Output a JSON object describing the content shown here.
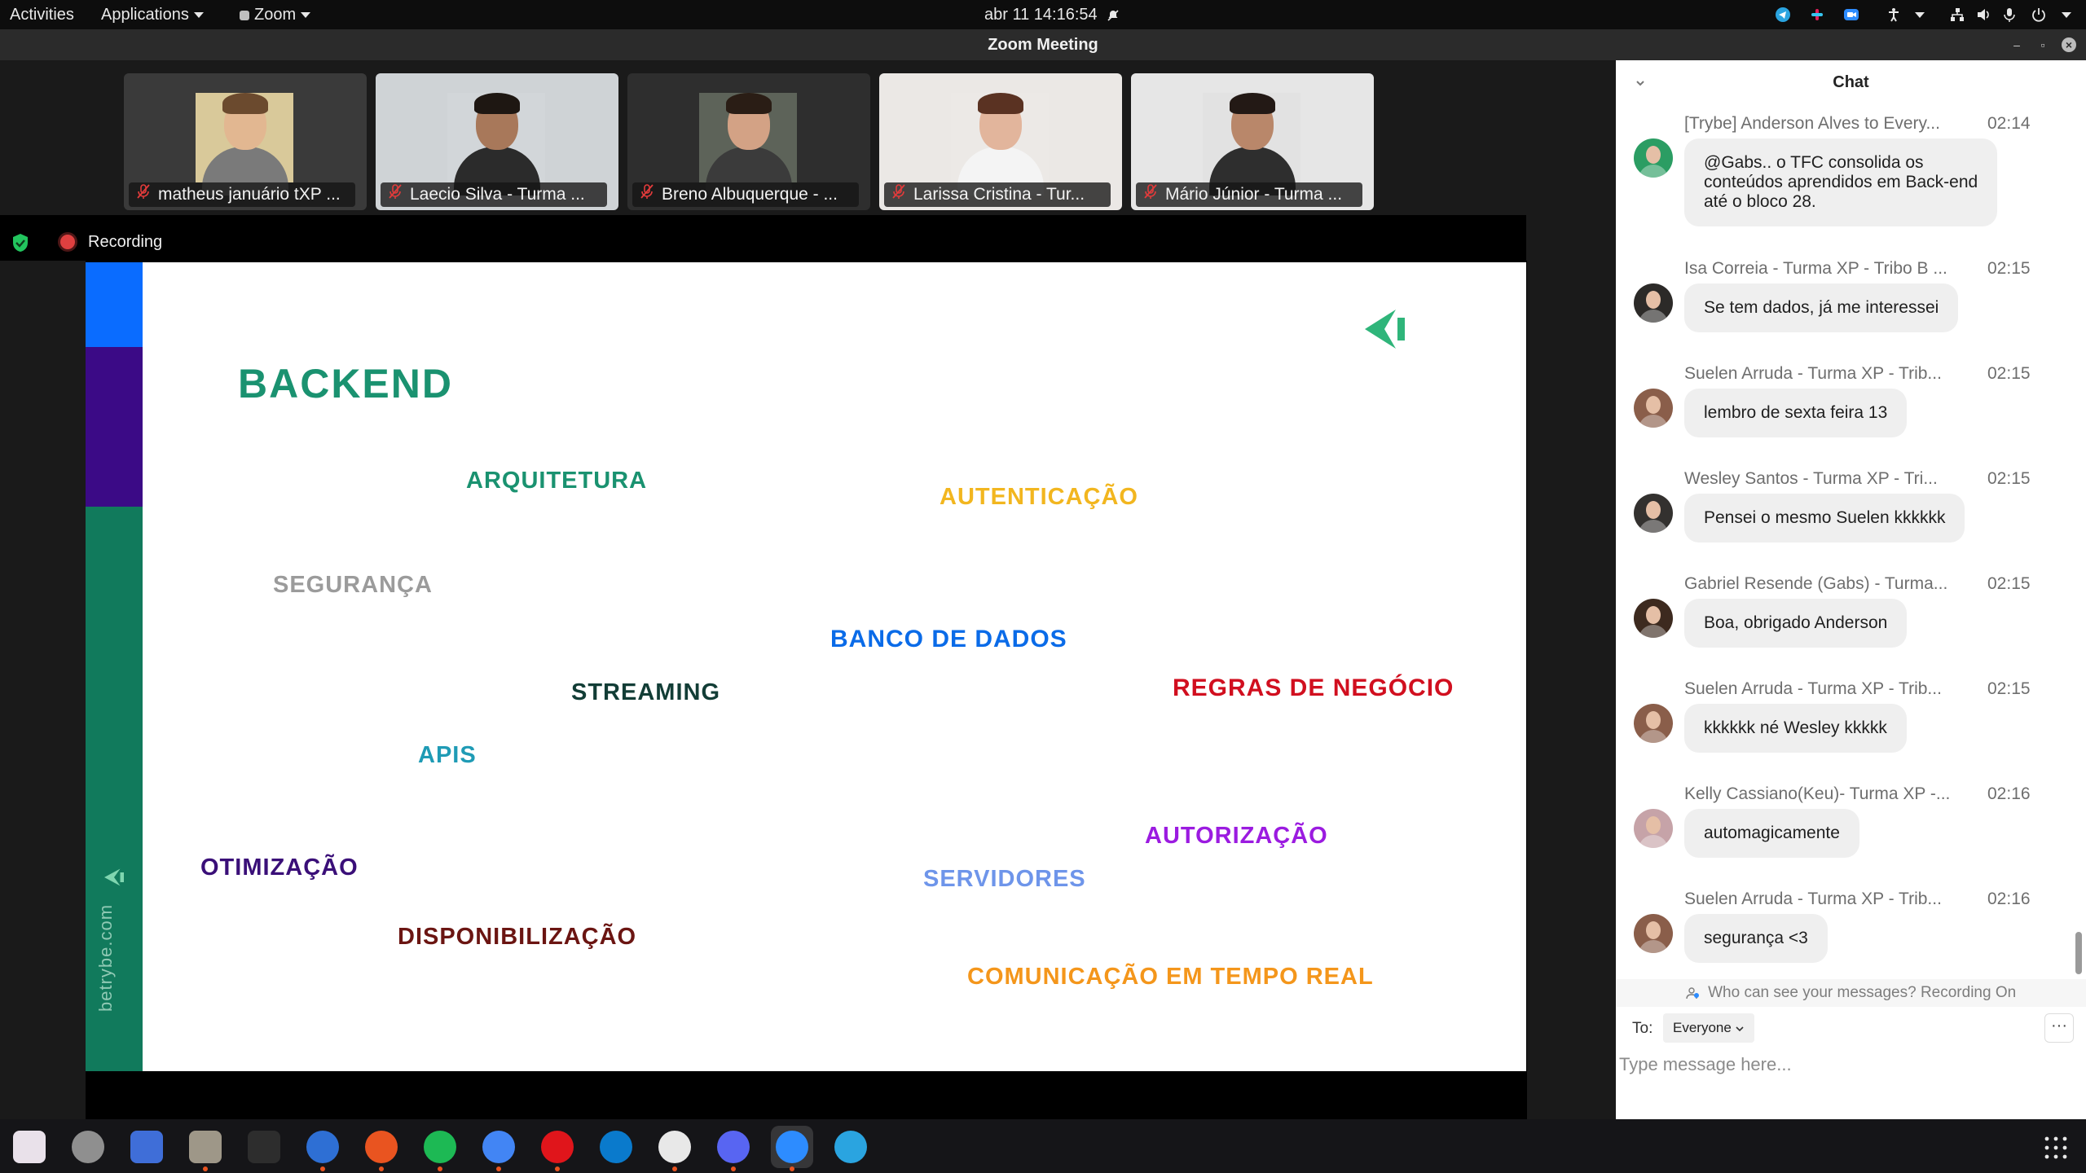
{
  "topbar": {
    "activities": "Activities",
    "applications": "Applications",
    "app_menu": "Zoom",
    "datetime": "abr 11  14:16:54"
  },
  "window": {
    "title": "Zoom Meeting"
  },
  "participants": [
    {
      "name": "matheus januário tXP ...",
      "bg": "#3a3a3a",
      "skin": "#e2b791",
      "hair": "#6b4a2e",
      "shirt": "#7a7a7a",
      "wall": "#d9c99a"
    },
    {
      "name": "Laecio Silva - Turma ...",
      "bg": "#cfd3d6",
      "skin": "#a8785a",
      "hair": "#1e1712",
      "shirt": "#2b2b2b",
      "wall": "#d2d6d9"
    },
    {
      "name": "Breno Albuquerque - ...",
      "bg": "#2e2e2e",
      "skin": "#d3a285",
      "hair": "#2a1d15",
      "shirt": "#3b3b3b",
      "wall": "#5d6359"
    },
    {
      "name": "Larissa Cristina - Tur...",
      "bg": "#ebe8e5",
      "skin": "#e2b59c",
      "hair": "#5a3222",
      "shirt": "#f4f4f4",
      "wall": "#ece9e6"
    },
    {
      "name": "Mário Júnior - Turma ...",
      "bg": "#e6e6e6",
      "skin": "#b9876a",
      "hair": "#231915",
      "shirt": "#2e2e2e",
      "wall": "#e2e2e2"
    }
  ],
  "recording": {
    "label": "Recording"
  },
  "slide": {
    "site": "betrybe.com",
    "title": "BACKEND",
    "words": [
      {
        "text": "ARQUITETURA",
        "color": "#1a9270"
      },
      {
        "text": "AUTENTICAÇÃO",
        "color": "#f2b61f"
      },
      {
        "text": "SEGURANÇA",
        "color": "#9b9b9b"
      },
      {
        "text": "BANCO DE DADOS",
        "color": "#0a6be8"
      },
      {
        "text": "STREAMING",
        "color": "#123d36"
      },
      {
        "text": "REGRAS DE NEGÓCIO",
        "color": "#d10f1f"
      },
      {
        "text": "APIS",
        "color": "#1f9bb5"
      },
      {
        "text": "AUTORIZAÇÃO",
        "color": "#9b1be0"
      },
      {
        "text": "OTIMIZAÇÃO",
        "color": "#3a0f78"
      },
      {
        "text": "SERVIDORES",
        "color": "#6e95ea"
      },
      {
        "text": "DISPONIBILIZAÇÃO",
        "color": "#6b1512"
      },
      {
        "text": "COMUNICAÇÃO EM TEMPO REAL",
        "color": "#f4961b"
      }
    ],
    "colors": {
      "title": "#1a9270",
      "logo": "#2fb57a"
    }
  },
  "chat": {
    "title": "Chat",
    "messages": [
      {
        "sender": "[Trybe] Anderson Alves to Every...",
        "time": "02:14",
        "text": "@Gabs.. o TFC consolida os\nconteúdos aprendidos em Back-end\naté o bloco 28.",
        "avatar": "#2b9d63"
      },
      {
        "sender": "Isa Correia - Turma XP - Tribo B ...",
        "time": "02:15",
        "text": "Se tem dados, já me interessei",
        "avatar": "#2c2a28"
      },
      {
        "sender": "Suelen Arruda - Turma XP - Trib...",
        "time": "02:15",
        "text": "lembro de sexta feira 13",
        "avatar": "#8a5e4a"
      },
      {
        "sender": "Wesley Santos - Turma XP - Tri...",
        "time": "02:15",
        "text": "Pensei o mesmo Suelen kkkkkk",
        "avatar": "#33312f"
      },
      {
        "sender": "Gabriel Resende (Gabs) - Turma...",
        "time": "02:15",
        "text": "Boa, obrigado Anderson",
        "avatar": "#3d2a1f"
      },
      {
        "sender": "Suelen Arruda - Turma XP - Trib...",
        "time": "02:15",
        "text": "kkkkkk né Wesley kkkkk",
        "avatar": "#8a5e4a"
      },
      {
        "sender": "Kelly Cassiano(Keu)- Turma XP -...",
        "time": "02:16",
        "text": "automagicamente",
        "avatar": "#c6a3a8"
      },
      {
        "sender": "Suelen Arruda - Turma XP - Trib...",
        "time": "02:16",
        "text": "segurança <3",
        "avatar": "#8a5e4a"
      }
    ],
    "visibility_note": "Who can see your messages? Recording On",
    "to_label": "To:",
    "to_value": "Everyone",
    "input_placeholder": "Type message here..."
  },
  "dock": {
    "apps": [
      {
        "name": "show-apps-launcher",
        "color": "#e9e1ea"
      },
      {
        "name": "settings",
        "color": "#8f8f8f"
      },
      {
        "name": "screenshot",
        "color": "#3f6ed8"
      },
      {
        "name": "files",
        "color": "#9e9788"
      },
      {
        "name": "terminal",
        "color": "#2d2d2d"
      },
      {
        "name": "thunderbird",
        "color": "#2e6fd4"
      },
      {
        "name": "software-center",
        "color": "#e95420"
      },
      {
        "name": "spotify",
        "color": "#1db954"
      },
      {
        "name": "chrome",
        "color": "#4285f4"
      },
      {
        "name": "opera",
        "color": "#e0151b"
      },
      {
        "name": "vscode",
        "color": "#0a7acc"
      },
      {
        "name": "slack",
        "color": "#e8e8e8"
      },
      {
        "name": "discord",
        "color": "#5865f2"
      },
      {
        "name": "zoom",
        "color": "#2d8cff"
      },
      {
        "name": "telegram",
        "color": "#2aa4e0"
      }
    ]
  }
}
